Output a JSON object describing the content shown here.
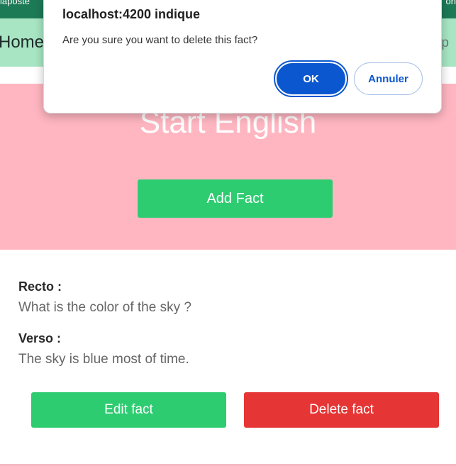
{
  "topbar": {
    "left_text": "laposte",
    "right_text": "on"
  },
  "navbar": {
    "home_label": "Home",
    "right_label": "p"
  },
  "hero": {
    "title": "Start English",
    "add_fact_label": "Add Fact"
  },
  "fact": {
    "recto_label": "Recto :",
    "recto_value": "What is the color of the sky ?",
    "verso_label": "Verso :",
    "verso_value": "The sky is blue most of time.",
    "edit_label": "Edit fact",
    "delete_label": "Delete fact"
  },
  "dialog": {
    "title": "localhost:4200 indique",
    "message": "Are you sure you want to delete this fact?",
    "ok_label": "OK",
    "cancel_label": "Annuler"
  },
  "colors": {
    "navbar": "#a8e6c3",
    "hero": "#ffb6c1",
    "green_button": "#2ecc71",
    "red_button": "#e53535",
    "dialog_accent": "#0b57d0"
  }
}
